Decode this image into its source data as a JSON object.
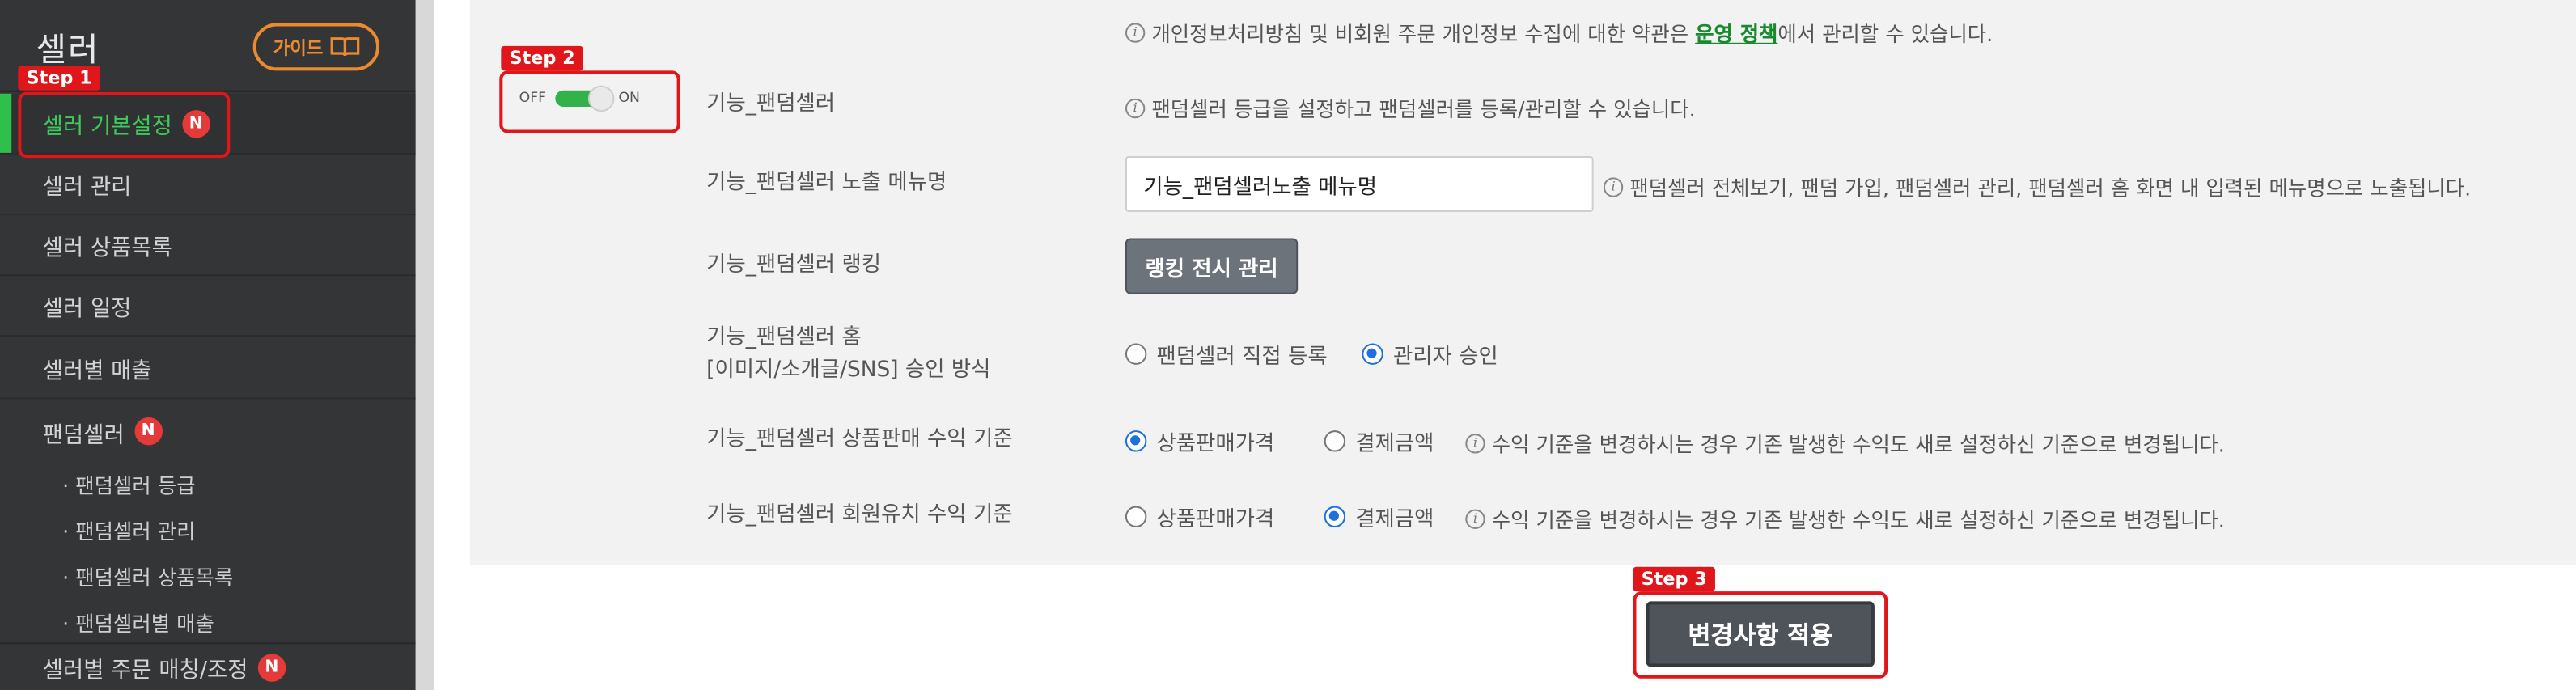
{
  "sidebar": {
    "title": "셀러",
    "guide_label": "가이드",
    "items": [
      {
        "label": "셀러 기본설정",
        "badge": "N"
      },
      {
        "label": "셀러 관리"
      },
      {
        "label": "셀러 상품목록"
      },
      {
        "label": "셀러 일정"
      },
      {
        "label": "셀러별 매출"
      },
      {
        "label": "팬덤셀러",
        "badge": "N"
      },
      {
        "label": "셀러별 주문 매칭/조정",
        "badge": "N"
      }
    ],
    "sub_items": [
      "· 팬덤셀러 등급",
      "· 팬덤셀러 관리",
      "· 팬덤셀러 상품목록",
      "· 팬덤셀러별 매출"
    ]
  },
  "content": {
    "top_info_prefix": "개인정보처리방침 및 비회원 주문 개인정보 수집에 대한 약관은 ",
    "top_info_link": "운영 정책",
    "top_info_suffix": "에서 관리할 수 있습니다.",
    "toggle": {
      "off": "OFF",
      "on": "ON",
      "state": "on"
    },
    "rows": {
      "fandom": {
        "label": "기능_팬덤셀러",
        "info": "팬덤셀러 등급을 설정하고 팬덤셀러를 등록/관리할 수 있습니다."
      },
      "menu_name": {
        "label": "기능_팬덤셀러 노출 메뉴명",
        "value": "기능_팬덤셀러노출 메뉴명",
        "info": "팬덤셀러 전체보기, 팬덤 가입, 팬덤셀러 관리, 팬덤셀러 홈 화면 내 입력된 메뉴명으로 노출됩니다."
      },
      "ranking": {
        "label": "기능_팬덤셀러 랭킹",
        "button": "랭킹 전시 관리"
      },
      "home_approval": {
        "label_line1": "기능_팬덤셀러 홈",
        "label_line2": "[이미지/소개글/SNS] 승인 방식",
        "options": [
          "팬덤셀러 직접 등록",
          "관리자 승인"
        ],
        "selected": "관리자 승인"
      },
      "sales_basis": {
        "label": "기능_팬덤셀러 상품판매 수익 기준",
        "options": [
          "상품판매가격",
          "결제금액"
        ],
        "selected": "상품판매가격",
        "info": "수익 기준을 변경하시는 경우 기존 발생한 수익도 새로 설정하신 기준으로 변경됩니다."
      },
      "member_basis": {
        "label": "기능_팬덤셀러 회원유치 수익 기준",
        "options": [
          "상품판매가격",
          "결제금액"
        ],
        "selected": "결제금액",
        "info": "수익 기준을 변경하시는 경우 기존 발생한 수익도 새로 설정하신 기준으로 변경됩니다."
      }
    },
    "apply_button": "변경사항 적용"
  },
  "steps": [
    "Step 1",
    "Step 2",
    "Step 3"
  ],
  "colors": {
    "accent_green": "#2fbf4b",
    "step_red": "#e0161b",
    "badge_red": "#e53a3a",
    "guide_orange": "#ec8a2f",
    "radio_blue": "#1f6fdc"
  }
}
